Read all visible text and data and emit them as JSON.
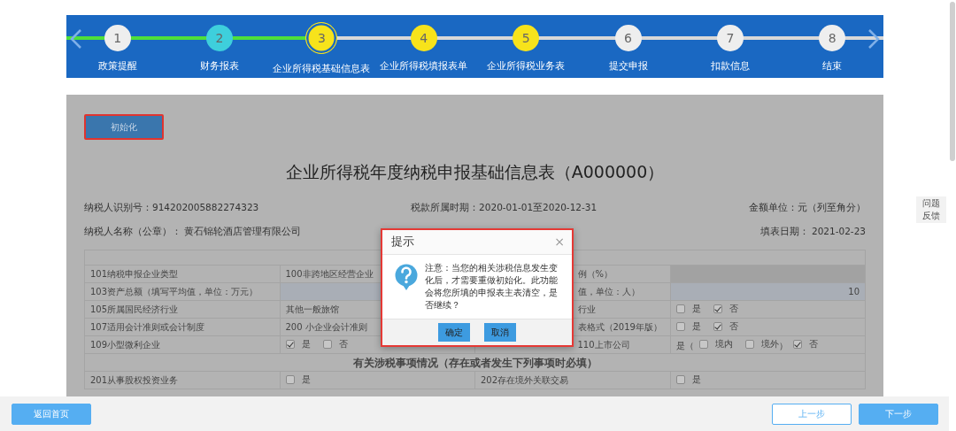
{
  "stepper": {
    "steps": [
      {
        "number": "1",
        "label": "政策提醒",
        "color": "#eeeeee",
        "completed": true,
        "selected": false
      },
      {
        "number": "2",
        "label": "财务报表",
        "color": "#3ecfdc",
        "completed": true,
        "selected": false
      },
      {
        "number": "3",
        "label": "企业所得税基础信息表",
        "color": "#f7e31b",
        "completed": false,
        "selected": true
      },
      {
        "number": "4",
        "label": "企业所得税填报表单",
        "color": "#f7e31b",
        "completed": false,
        "selected": false
      },
      {
        "number": "5",
        "label": "企业所得税业务表",
        "color": "#f7e31b",
        "completed": false,
        "selected": false
      },
      {
        "number": "6",
        "label": "提交申报",
        "color": "#eeeeee",
        "completed": false,
        "selected": false
      },
      {
        "number": "7",
        "label": "扣款信息",
        "color": "#eeeeee",
        "completed": false,
        "selected": false
      },
      {
        "number": "8",
        "label": "结束",
        "color": "#eeeeee",
        "completed": false,
        "selected": false
      }
    ]
  },
  "init_button": "初始化",
  "form": {
    "title": "企业所得税年度纳税申报基础信息表（A000000）",
    "taxpayer_id": "纳税人识别号：914202005882274323",
    "period": "税款所属时期：2020-01-01至2020-12-31",
    "unit": "金额单位：元（列至角分）",
    "taxpayer_name": "纳税人名称（公章）： 黄石锦轮酒店管理有限公司",
    "fill_date": "填表日期： 2021-02-23",
    "rows": [
      {
        "kind": "fields",
        "cells": [
          {
            "kind": "label",
            "text": "101纳税申报企业类型"
          },
          {
            "kind": "value",
            "text": "100非跨地区经营企业"
          },
          {
            "kind": "label",
            "text": "例（%）"
          },
          {
            "kind": "input",
            "disabled": true
          }
        ]
      },
      {
        "kind": "fields",
        "cells": [
          {
            "kind": "label",
            "text": "103资产总额（填写平均值，单位：万元）"
          },
          {
            "kind": "input",
            "disabled": false
          },
          {
            "kind": "label",
            "text": "值，单位：人）"
          },
          {
            "kind": "input",
            "disabled": false,
            "value": "10"
          }
        ]
      },
      {
        "kind": "fields",
        "cells": [
          {
            "kind": "label",
            "text": "105所属国民经济行业"
          },
          {
            "kind": "value",
            "text": "其他一般旅馆"
          },
          {
            "kind": "label",
            "text": "行业"
          },
          {
            "kind": "options",
            "parts": [
              {
                "kind": "check",
                "label": "是",
                "checked": false
              },
              {
                "kind": "check",
                "label": "否",
                "checked": true
              }
            ]
          }
        ]
      },
      {
        "kind": "fields",
        "cells": [
          {
            "kind": "label",
            "text": "107适用会计准则或会计制度"
          },
          {
            "kind": "value",
            "text": "200 小企业会计准则"
          },
          {
            "kind": "label",
            "text": "表格式（2019年版）"
          },
          {
            "kind": "options",
            "parts": [
              {
                "kind": "check",
                "label": "是",
                "checked": false
              },
              {
                "kind": "check",
                "label": "否",
                "checked": true
              }
            ]
          }
        ]
      },
      {
        "kind": "fields",
        "cells": [
          {
            "kind": "label",
            "text": "109小型微利企业"
          },
          {
            "kind": "options",
            "parts": [
              {
                "kind": "check",
                "label": "是",
                "checked": true
              },
              {
                "kind": "check",
                "label": "否",
                "checked": false
              }
            ]
          },
          {
            "kind": "label",
            "text": "110上市公司"
          },
          {
            "kind": "options",
            "parts": [
              {
                "kind": "text",
                "text": "是（"
              },
              {
                "kind": "check",
                "label": "境内",
                "checked": false
              },
              {
                "kind": "check",
                "label": "境外",
                "checked": false
              },
              {
                "kind": "text",
                "text": "）"
              },
              {
                "kind": "check",
                "label": "否",
                "checked": true
              }
            ]
          }
        ]
      },
      {
        "kind": "section",
        "text": "有关涉税事项情况（存在或者发生下列事项时必填）"
      },
      {
        "kind": "fields",
        "cells": [
          {
            "kind": "label",
            "text": "201从事股权投资业务"
          },
          {
            "kind": "options",
            "parts": [
              {
                "kind": "check",
                "label": "是",
                "checked": false
              }
            ]
          },
          {
            "kind": "label",
            "text": "202存在境外关联交易"
          },
          {
            "kind": "options",
            "parts": [
              {
                "kind": "check",
                "label": "是",
                "checked": false
              }
            ]
          }
        ]
      }
    ]
  },
  "dialog": {
    "title": "提示",
    "close": "×",
    "message": "注意：当您的相关涉税信息发生变化后，才需要重做初始化。此功能会将您所填的申报表主表清空，是否继续？",
    "buttons": [
      "确定",
      "取消"
    ]
  },
  "feedback_tab": "问题反馈",
  "footer": {
    "home": "返回首页",
    "prev": "上一步",
    "next": "下一步"
  }
}
